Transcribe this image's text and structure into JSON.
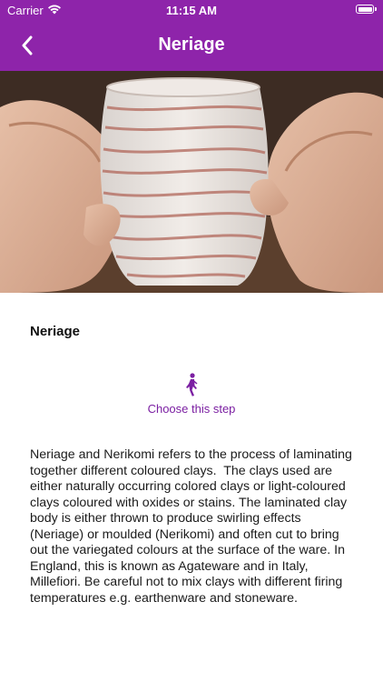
{
  "status_bar": {
    "carrier": "Carrier",
    "time": "11:15 AM"
  },
  "header": {
    "title": "Neriage",
    "background_color": "#8e24aa"
  },
  "step": {
    "heading": "Neriage",
    "choose_label": "Choose this step",
    "description": "Neriage and Nerikomi refers to the process of laminating together different coloured clays.  The clays used are either naturally occurring colored clays or light-coloured clays coloured with oxides or stains. The laminated clay body is either thrown to produce swirling effects (Neriage) or moulded (Nerikomi) and often cut to bring out the variegated colours at the surface of the ware. In England, this is known as Agateware and in Italy, Millefiori. Be careful not to mix clays with different firing temperatures e.g. earthenware and stoneware."
  },
  "icons": {
    "back": "chevron-left-icon",
    "walk": "walking-person-icon"
  }
}
